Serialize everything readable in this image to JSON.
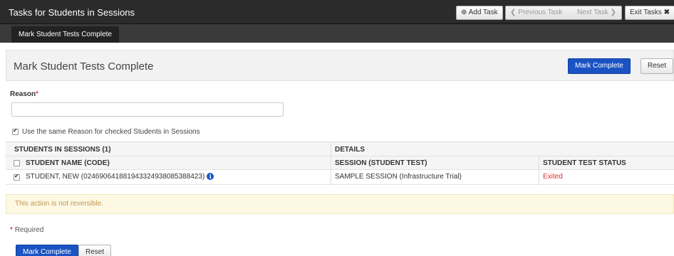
{
  "header": {
    "title": "Tasks for Students in Sessions",
    "add_task": "Add Task",
    "previous_task": "Previous Task",
    "next_task": "Next Task",
    "exit_tasks": "Exit Tasks"
  },
  "subnav": {
    "active_tab": "Mark Student Tests Complete"
  },
  "panel": {
    "heading": "Mark Student Tests Complete",
    "mark_complete": "Mark Complete",
    "reset": "Reset"
  },
  "form": {
    "reason_label": "Reason",
    "required_marker": "*",
    "reason_value": "",
    "same_reason_label": "Use the same Reason for checked Students in Sessions",
    "same_reason_checked": true
  },
  "table": {
    "group_students": "STUDENTS IN SESSIONS (1)",
    "group_details": "DETAILS",
    "col_student": "STUDENT NAME (CODE)",
    "col_session": "SESSION (STUDENT TEST)",
    "col_status": "STUDENT TEST STATUS",
    "rows": [
      {
        "student": "STUDENT, NEW (02469064188194332493808538842​3)",
        "session": "SAMPLE SESSION (Infrastructure Trial)",
        "status": "Exited",
        "checked": true
      }
    ]
  },
  "warning": "This action is not reversible.",
  "required_note": "Required",
  "footer": {
    "mark_complete": "Mark Complete",
    "reset": "Reset"
  },
  "colors": {
    "primary": "#1a53c4",
    "header_bg": "#2b2b2b",
    "status_exited": "#d9312b",
    "warning_bg": "#fcf8e3"
  }
}
